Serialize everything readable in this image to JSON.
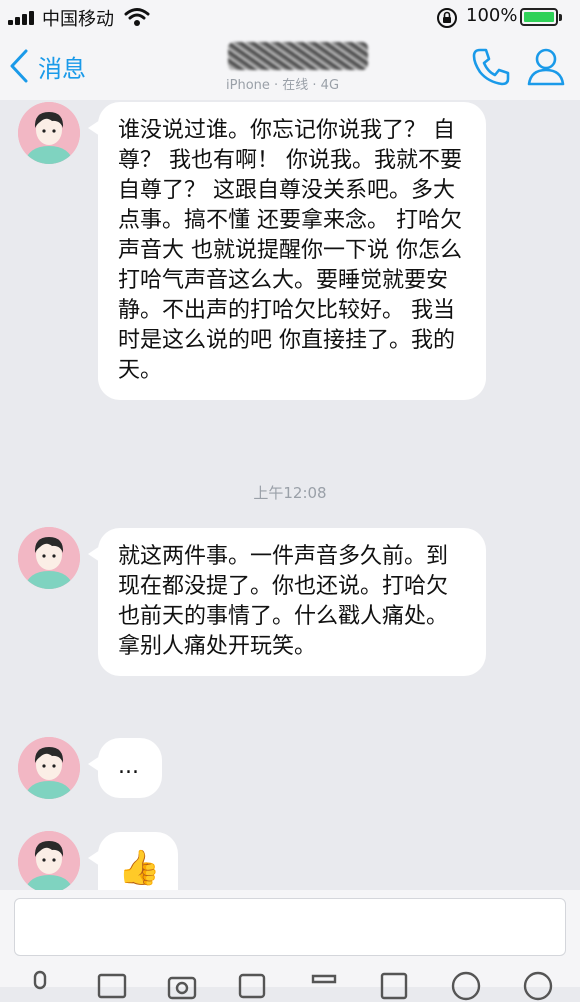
{
  "status": {
    "carrier": "中国移动",
    "battery": "100%"
  },
  "nav": {
    "back_label": "消息",
    "contact_status": "iPhone · 在线 · 4G"
  },
  "messages": [
    {
      "text": "谁没说过谁。你忘记你说我了？ 自尊？ 我也有啊！ 你说我。我就不要自尊了？ 这跟自尊没关系吧。多大点事。搞不懂 还要拿来念。 打哈欠声音大 也就说提醒你一下说 你怎么打哈气声音这么大。要睡觉就要安静。不出声的打哈欠比较好。 我当时是这么说的吧 你直接挂了。我的天。"
    },
    {
      "text": "就这两件事。一件声音多久前。到现在都没提了。你也还说。打哈欠也前天的事情了。什么戳人痛处。拿别人痛处开玩笑。"
    },
    {
      "text": "..."
    },
    {
      "emoji": "👍"
    }
  ],
  "timestamp": "上午12:08",
  "input": {
    "placeholder": ""
  },
  "colors": {
    "accent": "#1a9ae9",
    "bubble": "#ffffff",
    "background": "#e9eaee"
  },
  "icons": [
    "signal-icon",
    "wifi-icon",
    "rotation-lock-icon",
    "battery-icon",
    "back-chevron-icon",
    "phone-icon",
    "profile-icon"
  ]
}
